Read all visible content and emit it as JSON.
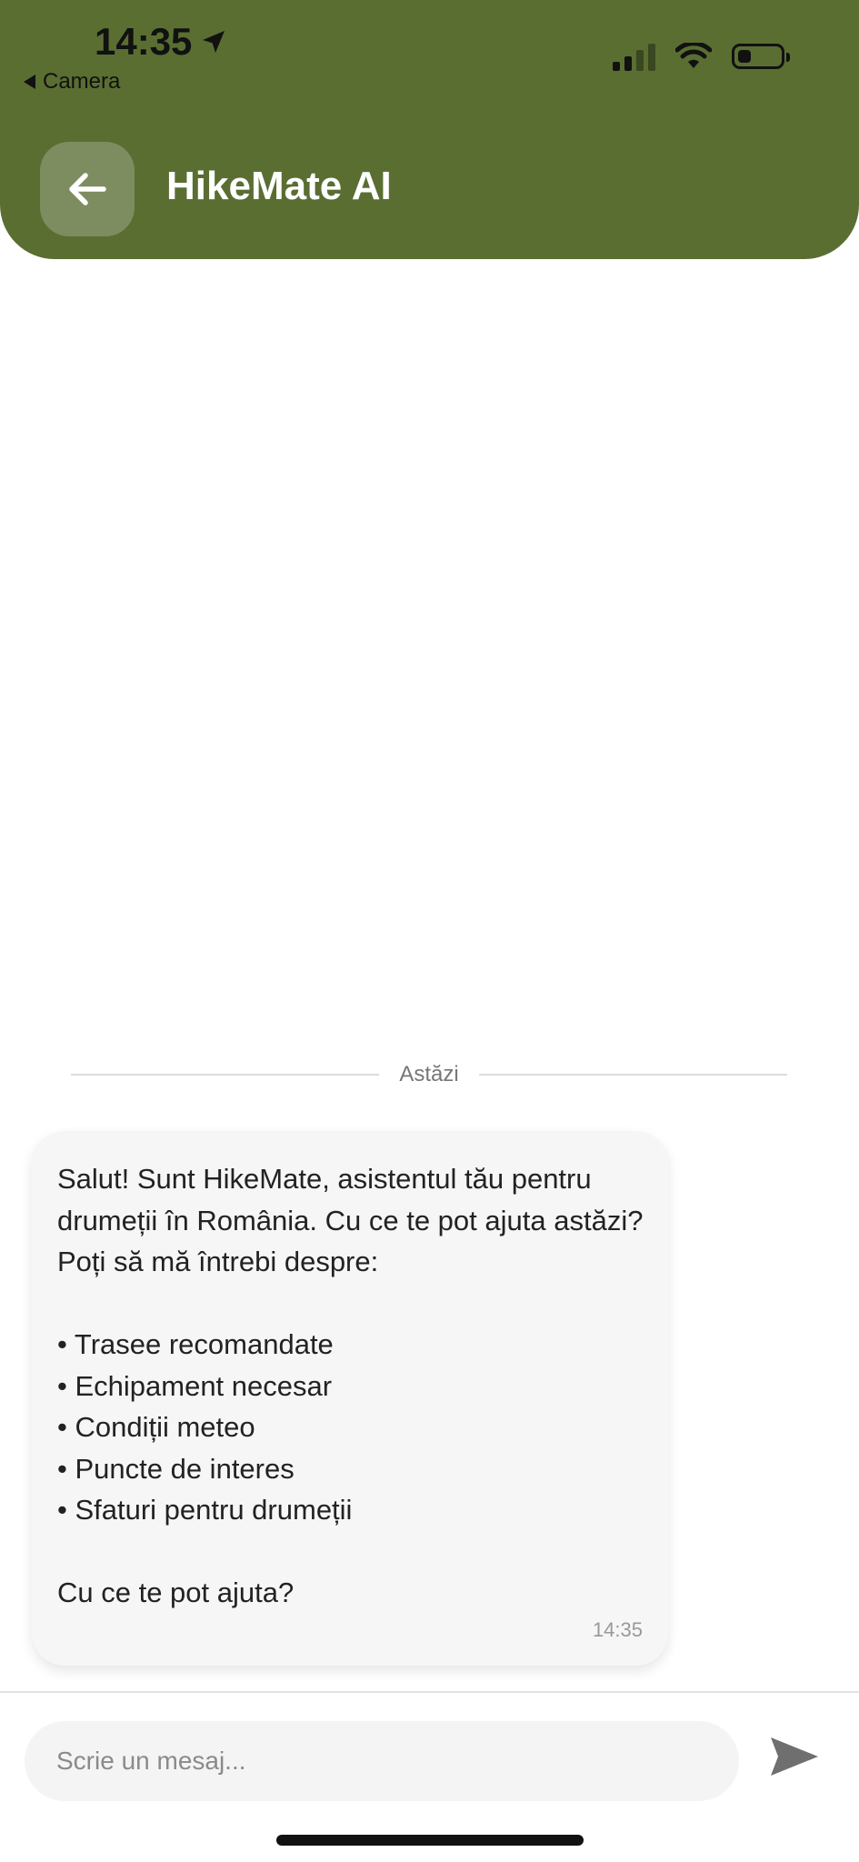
{
  "status_bar": {
    "time": "14:35",
    "back_app": "Camera",
    "location_icon": "location-arrow-icon",
    "signal_icon": "cellular-signal-icon",
    "wifi_icon": "wifi-icon",
    "battery_icon": "battery-icon"
  },
  "header": {
    "title": "HikeMate AI",
    "back_icon": "arrow-left-icon",
    "background": "#5a6e32"
  },
  "chat": {
    "date_separator": "Astăzi",
    "messages": [
      {
        "sender": "assistant",
        "intro": "Salut! Sunt HikeMate, asistentul tău pentru drumeții în România. Cu ce te pot ajuta astăzi? Poți să mă întrebi despre:",
        "bullets": [
          "• Trasee recomandate",
          "• Echipament necesar",
          "• Condiții meteo",
          "• Puncte de interes",
          "• Sfaturi pentru drumeții"
        ],
        "closing": "Cu ce te pot ajuta?",
        "time": "14:35"
      }
    ]
  },
  "composer": {
    "placeholder": "Scrie un mesaj...",
    "send_icon": "send-icon"
  }
}
